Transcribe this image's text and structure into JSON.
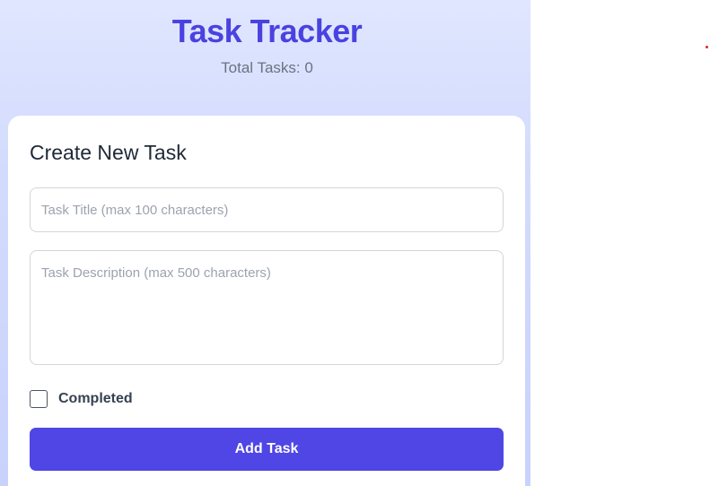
{
  "header": {
    "title": "Task Tracker",
    "task_count": "Total Tasks: 0"
  },
  "form": {
    "heading": "Create New Task",
    "title_input": {
      "value": "",
      "placeholder": "Task Title (max 100 characters)"
    },
    "description_input": {
      "value": "",
      "placeholder": "Task Description (max 500 characters)"
    },
    "completed_checkbox": {
      "label": "Completed",
      "checked": false
    },
    "submit_label": "Add Task"
  },
  "colors": {
    "accent": "#4f46e5",
    "title": "#4a42e0",
    "indicator_dot": "#dc2626"
  }
}
